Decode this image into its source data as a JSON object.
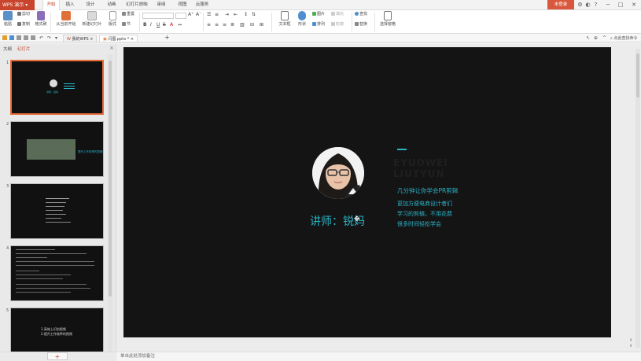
{
  "app": {
    "name": "WPS 演示",
    "login_label": "未登录"
  },
  "menu_tabs": [
    "开始",
    "插入",
    "设计",
    "动画",
    "幻灯片放映",
    "审阅",
    "视图",
    "云服务"
  ],
  "ribbon": {
    "paste": "粘贴",
    "cut": "剪切",
    "copy": "复制",
    "format_painter": "格式刷",
    "from_current": "从当前开始",
    "new_slide": "新建幻灯片",
    "layout": "版式",
    "reset": "重置",
    "section": "节",
    "textbox": "文本框",
    "shape": "形状",
    "picture": "图片",
    "arrange": "排列",
    "fill": "填充",
    "outline": "轮廓",
    "find": "查找",
    "replace": "替换",
    "select_pane": "选择窗格",
    "bold": "B",
    "italic": "I",
    "underline": "U",
    "strike": "S",
    "grow_font": "A⁺",
    "shrink_font": "A⁻"
  },
  "doc_tabs": [
    "我的WPS",
    "闪图.pptx *"
  ],
  "doc_tabs_right": "点此查找命令",
  "left_panel": {
    "tabs": [
      "大纲",
      "幻灯片"
    ],
    "slide_numbers": [
      "1",
      "2",
      "3",
      "4",
      "5"
    ],
    "thumb1_name": "讲师：锐妈",
    "thumb2_title": "提升工作效率的剪辑",
    "thumb5_lines": [
      "1.高效上识别视频",
      "2.提升工作效率的视频"
    ]
  },
  "notes_placeholder": "单击此处添加备注",
  "slide": {
    "lecturer": "讲师：锐妈",
    "ghost_text": [
      "EYUOWEI",
      "LIUTYUN"
    ],
    "subtitle": "几分钟让你学会PR剪辑",
    "desc": [
      "更加方便电商设计者们",
      "学习的剪辑，不用花费",
      "很多时间轻松学会"
    ]
  },
  "colors": {
    "accent": "#c8442c",
    "slide_text": "#2bb4c8",
    "slide_bg": "#141414"
  }
}
